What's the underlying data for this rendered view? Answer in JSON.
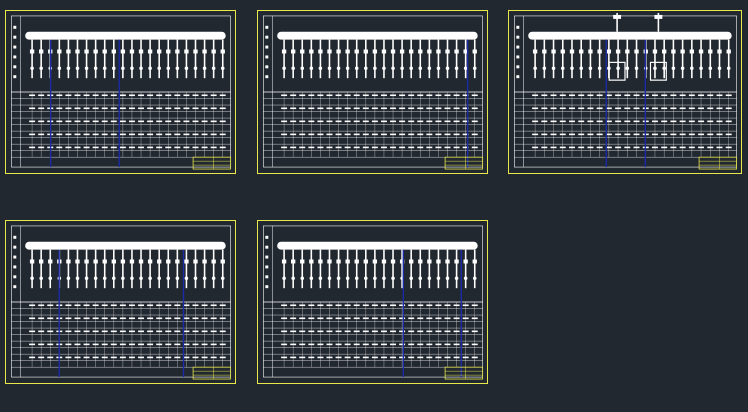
{
  "theme": {
    "background": "#212830",
    "frame_color": "#e8e84a",
    "line_color": "#ffffff",
    "divider_color": "#1b2aa8"
  },
  "sheets": [
    {
      "label": "",
      "bus_columns": 22,
      "table_rows": 10,
      "dividers": [
        0.16,
        0.48
      ],
      "extra_feeders": 0
    },
    {
      "label": "",
      "bus_columns": 22,
      "table_rows": 10,
      "dividers": [
        0.93
      ],
      "extra_feeders": 0
    },
    {
      "label": "",
      "bus_columns": 22,
      "table_rows": 10,
      "dividers": [
        0.4,
        0.58
      ],
      "extra_feeders": 2
    },
    {
      "label": "",
      "bus_columns": 22,
      "table_rows": 10,
      "dividers": [
        0.2,
        0.78
      ],
      "extra_feeders": 0
    },
    {
      "label": "",
      "bus_columns": 22,
      "table_rows": 10,
      "dividers": [
        0.63,
        0.9
      ],
      "extra_feeders": 0
    }
  ]
}
